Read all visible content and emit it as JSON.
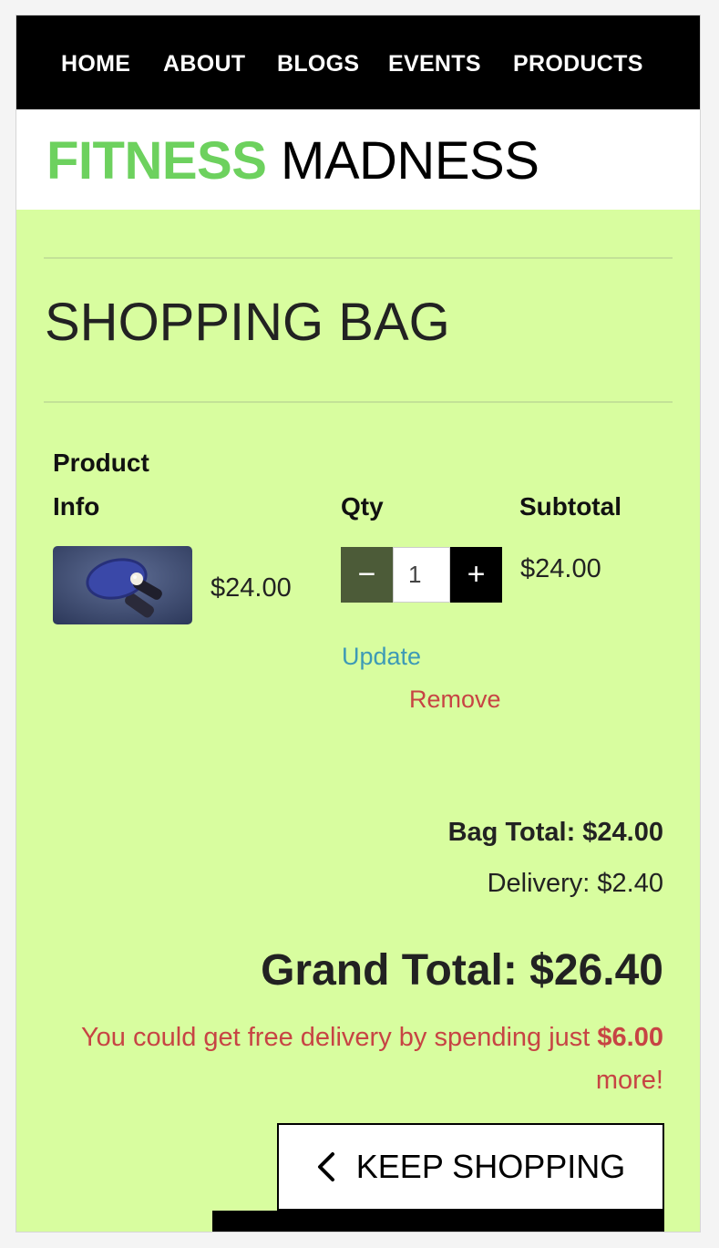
{
  "nav": {
    "items": [
      "HOME",
      "ABOUT",
      "BLOGS",
      "EVENTS",
      "PRODUCTS"
    ]
  },
  "brand": {
    "part1": "FITNESS",
    "part2": "MADNESS",
    "accent_color": "#6dd15e"
  },
  "page": {
    "title": "SHOPPING BAG"
  },
  "table": {
    "headers": {
      "product_line1": "Product",
      "product_line2": "Info",
      "qty": "Qty",
      "subtotal": "Subtotal"
    },
    "rows": [
      {
        "image_icon": "ping-pong-paddles-image",
        "price": "$24.00",
        "qty": "1",
        "subtotal": "$24.00",
        "update_label": "Update",
        "remove_label": "Remove",
        "decrement_icon": "−",
        "increment_icon": "+"
      }
    ]
  },
  "totals": {
    "bag_total": "Bag Total: $24.00",
    "delivery": "Delivery: $2.40",
    "grand_total": "Grand Total: $26.40",
    "free_delivery_prefix": "You could get free delivery by spending just",
    "free_delivery_amount": "$6.00",
    "free_delivery_suffix": "more!"
  },
  "actions": {
    "keep_shopping": "KEEP SHOPPING",
    "keep_shopping_icon": "chevron-left-icon"
  },
  "colors": {
    "background": "#d8fd9f",
    "nav": "#000000",
    "danger": "#c74444",
    "info": "#3d9ab6"
  }
}
